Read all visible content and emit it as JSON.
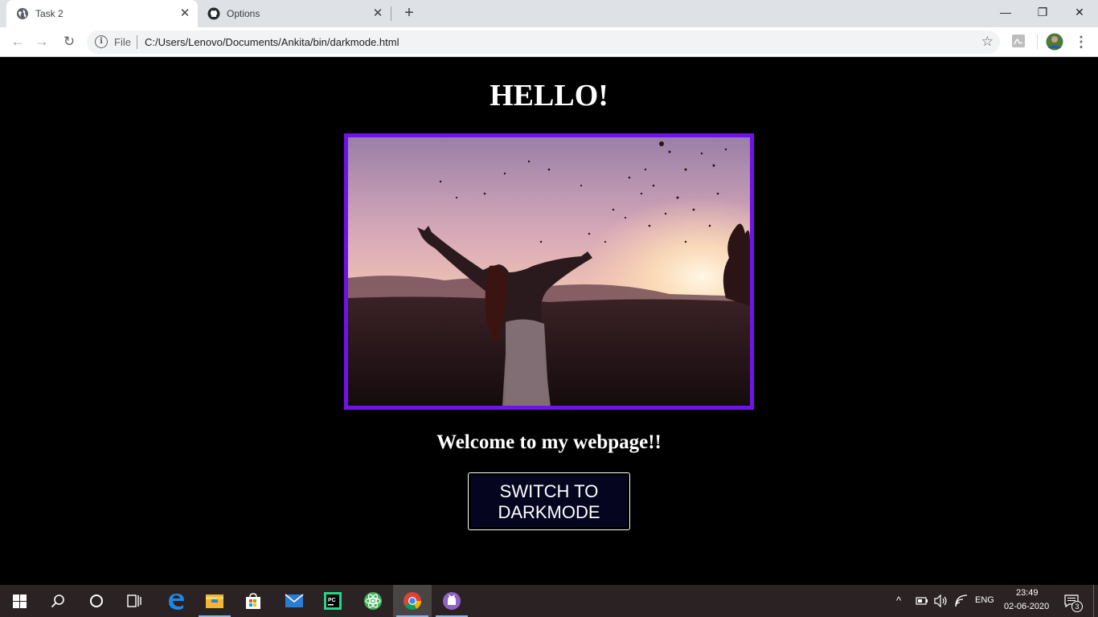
{
  "browser": {
    "tabs": [
      {
        "title": "Task 2",
        "icon": "globe-icon",
        "active": true
      },
      {
        "title": "Options",
        "icon": "github-icon",
        "active": false
      }
    ],
    "address": {
      "scheme_label": "File",
      "url": "C:/Users/Lenovo/Documents/Ankita/bin/darkmode.html"
    }
  },
  "page": {
    "heading": "HELLO!",
    "image_subject": "girl-silhouette-sunset-photo",
    "frame_color": "#7112e8",
    "welcome": "Welcome to my webpage!!",
    "button_line1": "SWITCH TO",
    "button_line2": "DARKMODE"
  },
  "taskbar": {
    "apps": [
      "start-icon",
      "search-icon",
      "cortana-icon",
      "task-view-icon",
      "edge-icon",
      "file-explorer-icon",
      "store-icon",
      "mail-icon",
      "pycharm-icon",
      "atom-icon",
      "chrome-icon",
      "github-desktop-icon"
    ],
    "language": "ENG",
    "time": "23:49",
    "date": "02-06-2020",
    "notifications": "3"
  }
}
